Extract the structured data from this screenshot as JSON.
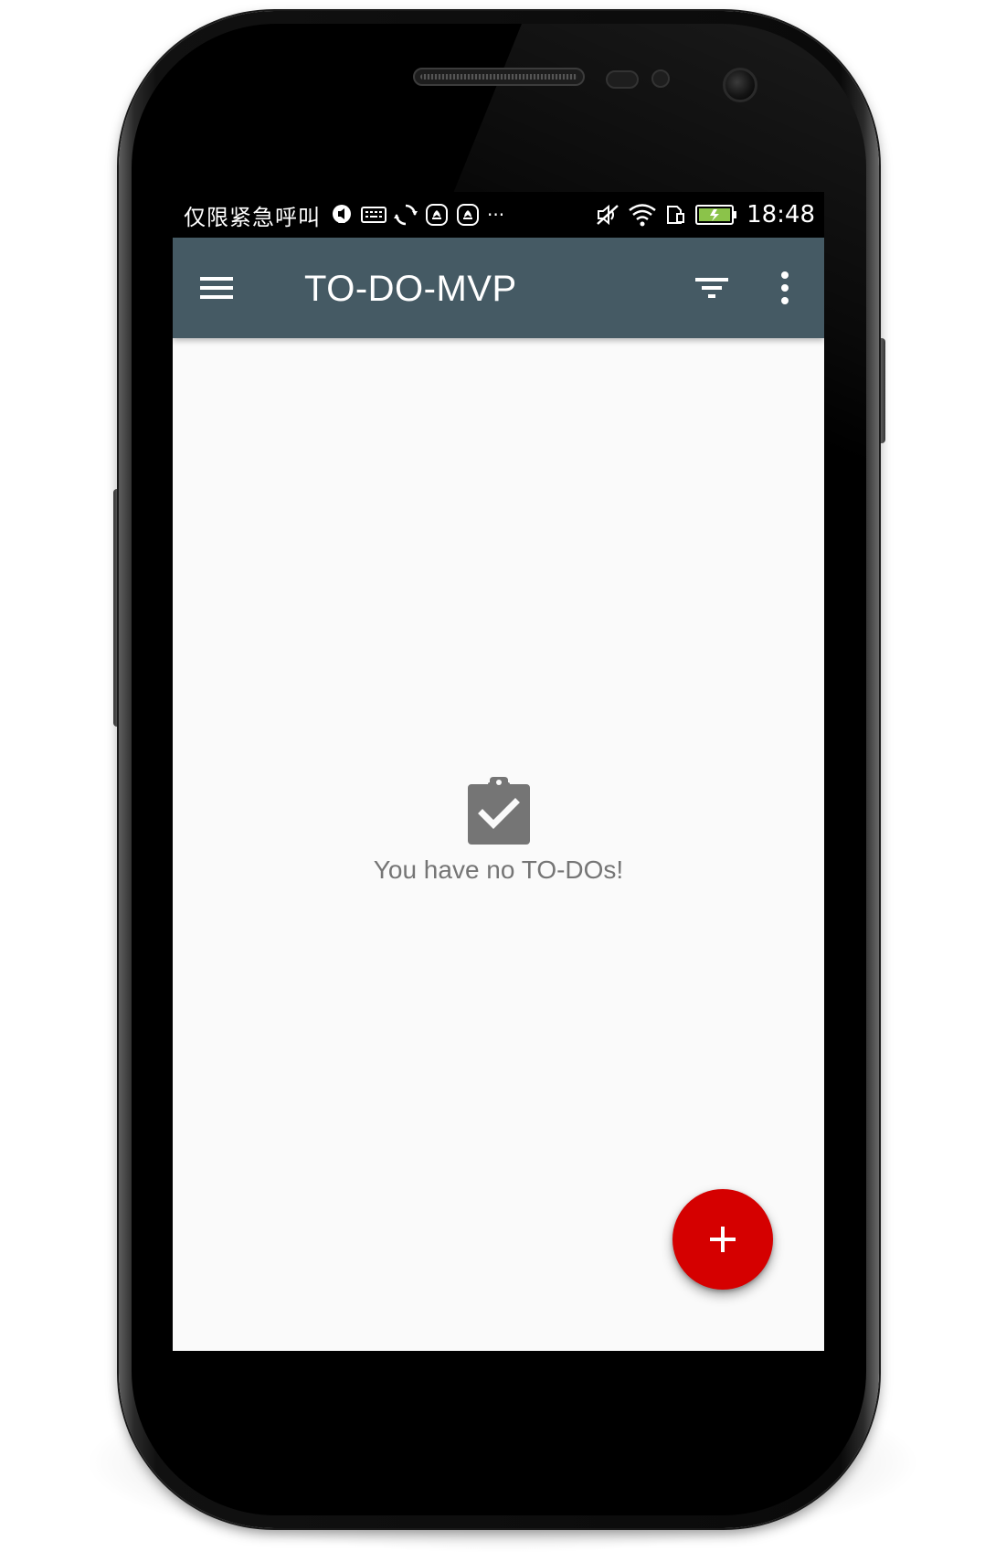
{
  "status_bar": {
    "carrier_text": "仅限紧急呼叫",
    "dots": "···",
    "time": "18:48"
  },
  "toolbar": {
    "title": "TO-DO-MVP",
    "background": "#455a64"
  },
  "empty_state": {
    "message": "You have no TO-DOs!",
    "icon": "clipboard-check-icon"
  },
  "fab": {
    "icon": "add-icon",
    "color": "#d50000"
  }
}
